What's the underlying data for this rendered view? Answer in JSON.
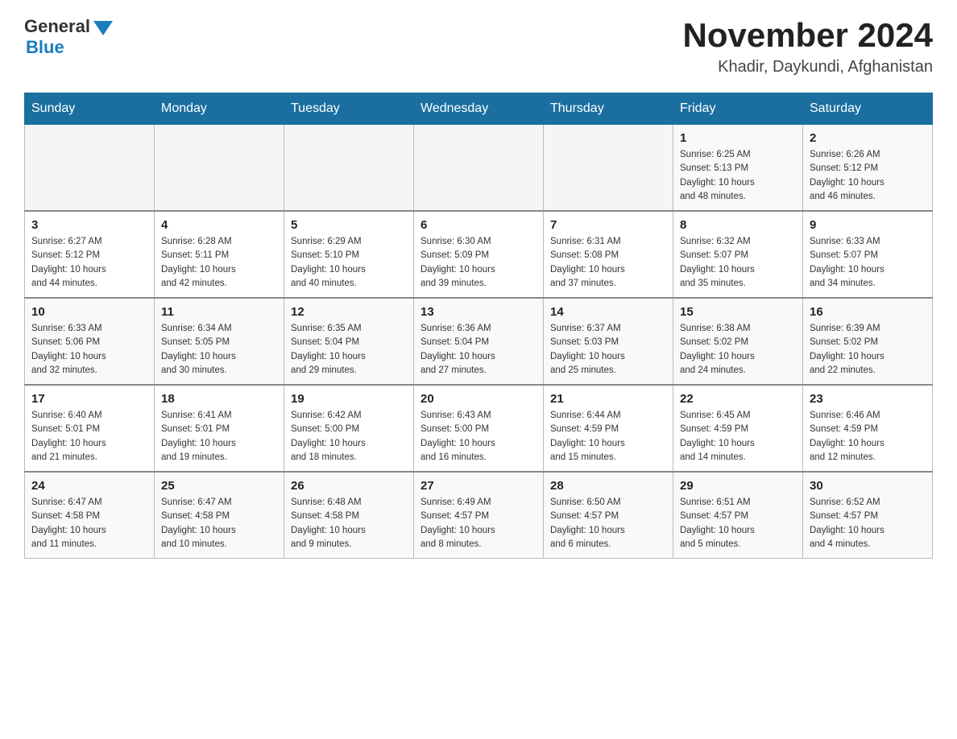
{
  "header": {
    "logo_general": "General",
    "logo_blue": "Blue",
    "main_title": "November 2024",
    "subtitle": "Khadir, Daykundi, Afghanistan"
  },
  "days_of_week": [
    "Sunday",
    "Monday",
    "Tuesday",
    "Wednesday",
    "Thursday",
    "Friday",
    "Saturday"
  ],
  "weeks": [
    {
      "cells": [
        {
          "date": "",
          "info": ""
        },
        {
          "date": "",
          "info": ""
        },
        {
          "date": "",
          "info": ""
        },
        {
          "date": "",
          "info": ""
        },
        {
          "date": "",
          "info": ""
        },
        {
          "date": "1",
          "info": "Sunrise: 6:25 AM\nSunset: 5:13 PM\nDaylight: 10 hours\nand 48 minutes."
        },
        {
          "date": "2",
          "info": "Sunrise: 6:26 AM\nSunset: 5:12 PM\nDaylight: 10 hours\nand 46 minutes."
        }
      ]
    },
    {
      "cells": [
        {
          "date": "3",
          "info": "Sunrise: 6:27 AM\nSunset: 5:12 PM\nDaylight: 10 hours\nand 44 minutes."
        },
        {
          "date": "4",
          "info": "Sunrise: 6:28 AM\nSunset: 5:11 PM\nDaylight: 10 hours\nand 42 minutes."
        },
        {
          "date": "5",
          "info": "Sunrise: 6:29 AM\nSunset: 5:10 PM\nDaylight: 10 hours\nand 40 minutes."
        },
        {
          "date": "6",
          "info": "Sunrise: 6:30 AM\nSunset: 5:09 PM\nDaylight: 10 hours\nand 39 minutes."
        },
        {
          "date": "7",
          "info": "Sunrise: 6:31 AM\nSunset: 5:08 PM\nDaylight: 10 hours\nand 37 minutes."
        },
        {
          "date": "8",
          "info": "Sunrise: 6:32 AM\nSunset: 5:07 PM\nDaylight: 10 hours\nand 35 minutes."
        },
        {
          "date": "9",
          "info": "Sunrise: 6:33 AM\nSunset: 5:07 PM\nDaylight: 10 hours\nand 34 minutes."
        }
      ]
    },
    {
      "cells": [
        {
          "date": "10",
          "info": "Sunrise: 6:33 AM\nSunset: 5:06 PM\nDaylight: 10 hours\nand 32 minutes."
        },
        {
          "date": "11",
          "info": "Sunrise: 6:34 AM\nSunset: 5:05 PM\nDaylight: 10 hours\nand 30 minutes."
        },
        {
          "date": "12",
          "info": "Sunrise: 6:35 AM\nSunset: 5:04 PM\nDaylight: 10 hours\nand 29 minutes."
        },
        {
          "date": "13",
          "info": "Sunrise: 6:36 AM\nSunset: 5:04 PM\nDaylight: 10 hours\nand 27 minutes."
        },
        {
          "date": "14",
          "info": "Sunrise: 6:37 AM\nSunset: 5:03 PM\nDaylight: 10 hours\nand 25 minutes."
        },
        {
          "date": "15",
          "info": "Sunrise: 6:38 AM\nSunset: 5:02 PM\nDaylight: 10 hours\nand 24 minutes."
        },
        {
          "date": "16",
          "info": "Sunrise: 6:39 AM\nSunset: 5:02 PM\nDaylight: 10 hours\nand 22 minutes."
        }
      ]
    },
    {
      "cells": [
        {
          "date": "17",
          "info": "Sunrise: 6:40 AM\nSunset: 5:01 PM\nDaylight: 10 hours\nand 21 minutes."
        },
        {
          "date": "18",
          "info": "Sunrise: 6:41 AM\nSunset: 5:01 PM\nDaylight: 10 hours\nand 19 minutes."
        },
        {
          "date": "19",
          "info": "Sunrise: 6:42 AM\nSunset: 5:00 PM\nDaylight: 10 hours\nand 18 minutes."
        },
        {
          "date": "20",
          "info": "Sunrise: 6:43 AM\nSunset: 5:00 PM\nDaylight: 10 hours\nand 16 minutes."
        },
        {
          "date": "21",
          "info": "Sunrise: 6:44 AM\nSunset: 4:59 PM\nDaylight: 10 hours\nand 15 minutes."
        },
        {
          "date": "22",
          "info": "Sunrise: 6:45 AM\nSunset: 4:59 PM\nDaylight: 10 hours\nand 14 minutes."
        },
        {
          "date": "23",
          "info": "Sunrise: 6:46 AM\nSunset: 4:59 PM\nDaylight: 10 hours\nand 12 minutes."
        }
      ]
    },
    {
      "cells": [
        {
          "date": "24",
          "info": "Sunrise: 6:47 AM\nSunset: 4:58 PM\nDaylight: 10 hours\nand 11 minutes."
        },
        {
          "date": "25",
          "info": "Sunrise: 6:47 AM\nSunset: 4:58 PM\nDaylight: 10 hours\nand 10 minutes."
        },
        {
          "date": "26",
          "info": "Sunrise: 6:48 AM\nSunset: 4:58 PM\nDaylight: 10 hours\nand 9 minutes."
        },
        {
          "date": "27",
          "info": "Sunrise: 6:49 AM\nSunset: 4:57 PM\nDaylight: 10 hours\nand 8 minutes."
        },
        {
          "date": "28",
          "info": "Sunrise: 6:50 AM\nSunset: 4:57 PM\nDaylight: 10 hours\nand 6 minutes."
        },
        {
          "date": "29",
          "info": "Sunrise: 6:51 AM\nSunset: 4:57 PM\nDaylight: 10 hours\nand 5 minutes."
        },
        {
          "date": "30",
          "info": "Sunrise: 6:52 AM\nSunset: 4:57 PM\nDaylight: 10 hours\nand 4 minutes."
        }
      ]
    }
  ]
}
